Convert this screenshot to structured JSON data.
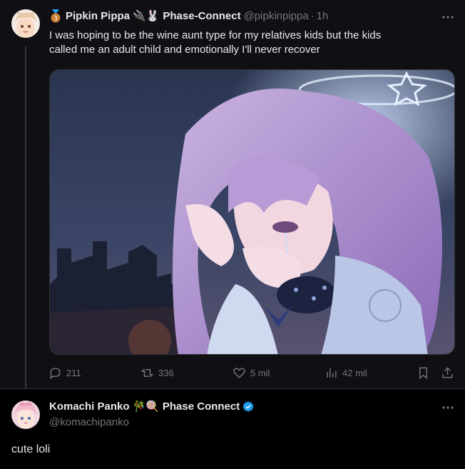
{
  "parent_tweet": {
    "display_name": "Pipkin Pippa",
    "name_badges": "🔌🐰",
    "affiliation": "Phase-Connect",
    "handle": "@pipkinpippa",
    "separator": "·",
    "time": "1h",
    "text_line1": "I was hoping to be the wine aunt type for my relatives kids but the kids",
    "text_line2": "called me an adult child and emotionally I'll never recover",
    "media_description_icon": "anime-illustration",
    "actions": {
      "replies": "211",
      "reposts": "336",
      "likes": "5 mil",
      "views": "42 mil"
    }
  },
  "reply_tweet": {
    "display_name": "Komachi Panko",
    "name_badges": "🎋🍭",
    "affiliation": "Phase Connect",
    "handle": "@komachipanko",
    "text": "cute loli"
  },
  "colors": {
    "background": "#000000",
    "text_primary": "#e7e9ea",
    "text_secondary": "#71767b",
    "verified_blue": "#1d9bf0",
    "badge_bronze": "#cd7f32"
  }
}
